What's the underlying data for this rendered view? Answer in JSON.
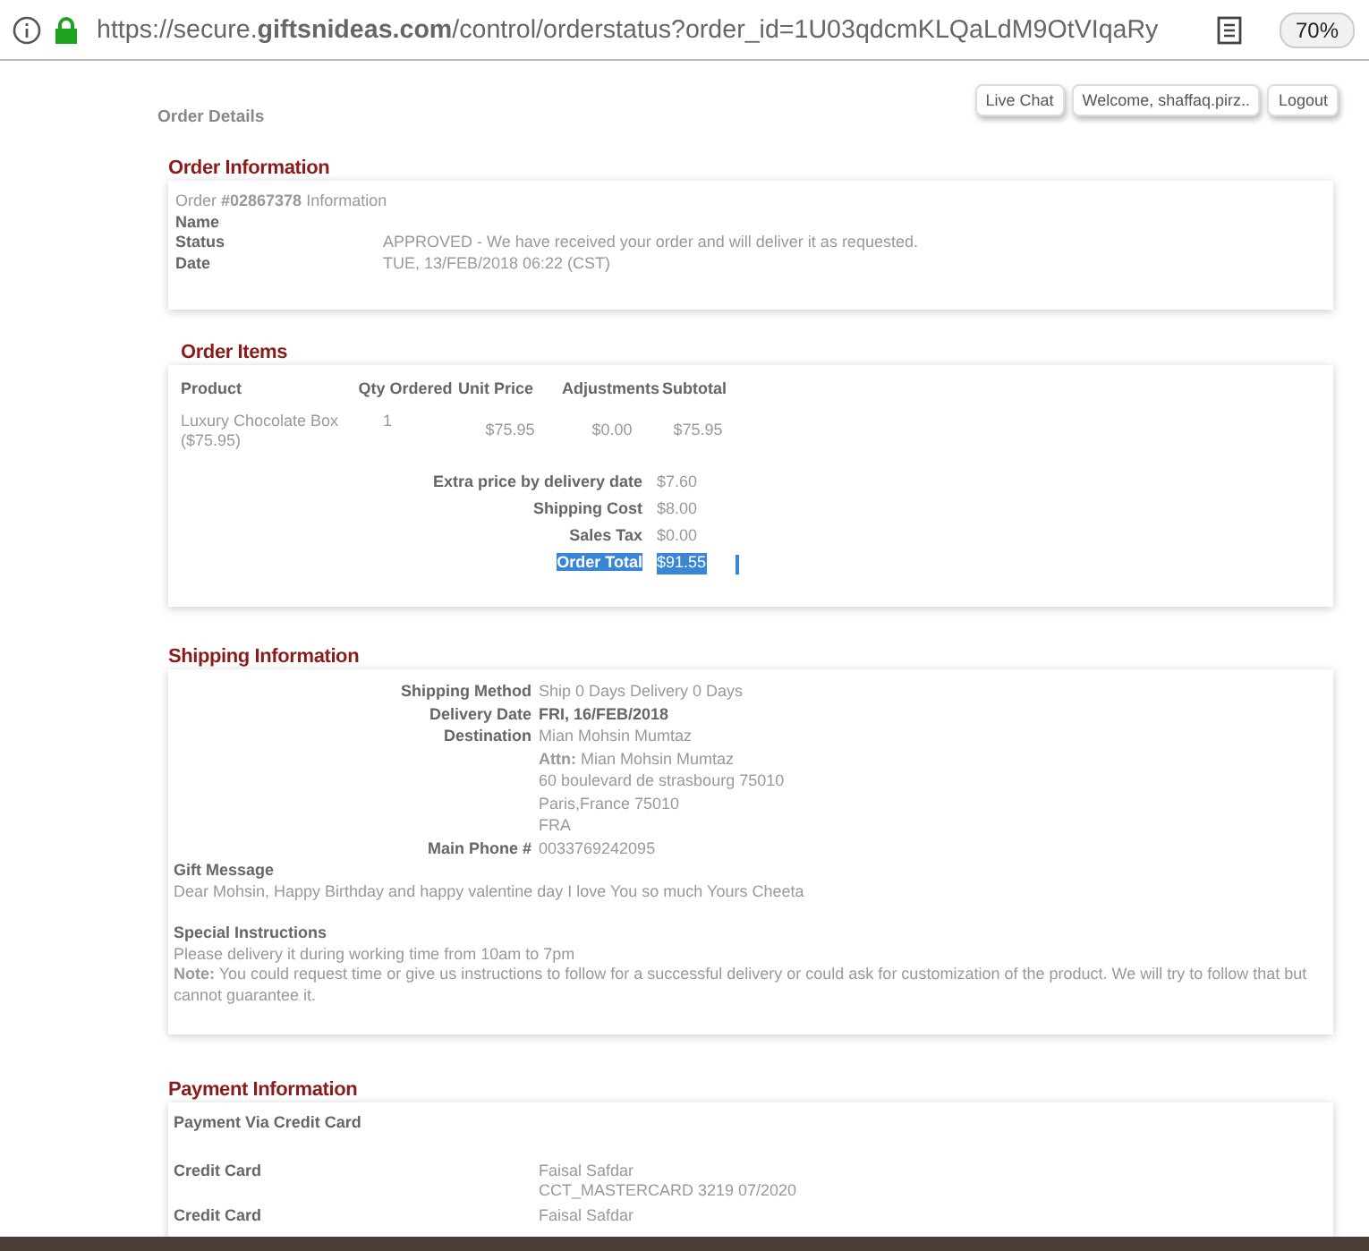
{
  "browser": {
    "url": "https://secure.**giftsnideas.com**/control/orderstatus?order_id=1U03qdcmKLQaLdM9OtVIqaRy",
    "zoom": "70%"
  },
  "header": {
    "breadcrumb": "Order Details",
    "buttons": [
      "Live Chat",
      "Welcome, shaffaq.pirz..",
      "Logout"
    ]
  },
  "order_information": {
    "heading": "Order Information",
    "order_line": "Order **#02867378** Information",
    "rows": [
      {
        "label": "Name"
      },
      {
        "label": "Status",
        "value": "APPROVED - We have received your order and will deliver it as requested."
      },
      {
        "label": "Date",
        "value": "TUE, 13/FEB/2018 06:22 (CST)"
      }
    ]
  },
  "order_items": {
    "heading": "Order Items",
    "columns": [
      "Product",
      "Qty Ordered",
      "Unit Price",
      "Adjustments",
      "Subtotal"
    ],
    "rows": [
      {
        "product": "Luxury Chocolate Box ($75.95)",
        "qty": "1",
        "unit_price": "$75.95",
        "adjustments": "$0.00",
        "subtotal": "$75.95"
      }
    ],
    "totals": [
      {
        "label": "Extra price by delivery date",
        "value": "$7.60",
        "highlighted": false
      },
      {
        "label": "Shipping Cost",
        "value": "$8.00",
        "highlighted": false
      },
      {
        "label": "Sales Tax",
        "value": "$0.00",
        "highlighted": false
      },
      {
        "label": "Order Total",
        "value": "$91.55",
        "highlighted": true
      }
    ]
  },
  "shipping_information": {
    "heading": "Shipping Information",
    "rows": [
      {
        "label": "Shipping Method",
        "lines": [
          "Ship 0 Days Delivery 0 Days"
        ],
        "bold": false
      },
      {
        "label": "Delivery Date",
        "lines": [
          "FRI, 16/FEB/2018"
        ],
        "bold": true
      },
      {
        "label": "Destination",
        "lines": [
          "Mian Mohsin Mumtaz",
          "**Attn:** Mian Mohsin Mumtaz",
          "60 boulevard de strasbourg 75010",
          "Paris,France 75010",
          "FRA"
        ],
        "bold": false
      },
      {
        "label": "Main Phone #",
        "lines": [
          "0033769242095"
        ],
        "bold": false
      }
    ],
    "gift_message": {
      "title": "Gift Message",
      "text": "Dear Mohsin, Happy Birthday and happy valentine day I love You so much Yours Cheeta"
    },
    "special_instructions": {
      "title": "Special Instructions",
      "text": "Please delivery it during working time from 10am to 7pm",
      "note": "**Note:** You could request time or give us instructions to follow for a successful delivery or could ask for customization of the product. We will try to follow that but cannot guarantee it."
    }
  },
  "payment_information": {
    "heading": "Payment Information",
    "title": "Payment Via Credit Card",
    "cards": [
      {
        "label": "Credit Card",
        "lines": [
          "Faisal Safdar",
          "CCT_MASTERCARD 3219 07/2020"
        ]
      },
      {
        "label": "Credit Card",
        "lines": [
          "Faisal Safdar"
        ]
      }
    ]
  }
}
